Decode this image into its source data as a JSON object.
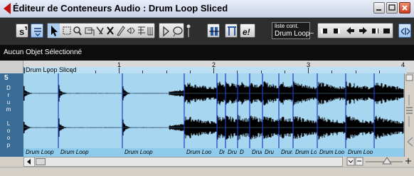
{
  "window": {
    "title": "Éditeur de Conteneurs Audio : Drum Loop Sliced",
    "buttons": {
      "minimize": "minimize",
      "maximize": "maximize",
      "close": "close"
    }
  },
  "toolbar": {
    "loop": {
      "label": "liste cont.",
      "value": "Drum Loop~"
    },
    "icons": [
      "solo-icon",
      "autoscroll-icon",
      "pointer-icon",
      "range-select-icon",
      "zoom-icon",
      "select-object-icon",
      "glue-icon",
      "mute-erase-icon",
      "pencil-icon",
      "audition-icon",
      "scrub-icon",
      "time-warp-icon",
      "play-icon",
      "loop-icon",
      "snap-icon",
      "bar-icon",
      "edit-in-place-icon",
      "nav-icons",
      "link-icon"
    ]
  },
  "info_line": {
    "text": "Aucun Objet Sélectionné"
  },
  "ruler": {
    "event_name": "Drum Loop Sliced",
    "bar_numbers": [
      "1",
      "2",
      "3",
      "4"
    ]
  },
  "track": {
    "number": "5",
    "name_chars": [
      "D",
      "r",
      "u",
      "m",
      " ",
      "L",
      "o",
      "o",
      "p"
    ],
    "color": "#3a6c98"
  },
  "slices": [
    {
      "label": "Drum Loop"
    },
    {
      "label": "Drum Loop"
    },
    {
      "label": "Drum Loop"
    },
    {
      "label": "Drum Loo"
    },
    {
      "label": "Dru"
    },
    {
      "label": "Dru"
    },
    {
      "label": "D"
    },
    {
      "label": "Drum"
    },
    {
      "label": "Dru"
    },
    {
      "label": "Drum"
    },
    {
      "label": "Drum Loo"
    },
    {
      "label": "Drum Loo"
    },
    {
      "label": "Drum Loo"
    }
  ],
  "colors": {
    "wave_bg": "#a7d6f1",
    "wave": "#000000",
    "slice_line": "#1d3fc9",
    "accent_red": "#c01010"
  }
}
